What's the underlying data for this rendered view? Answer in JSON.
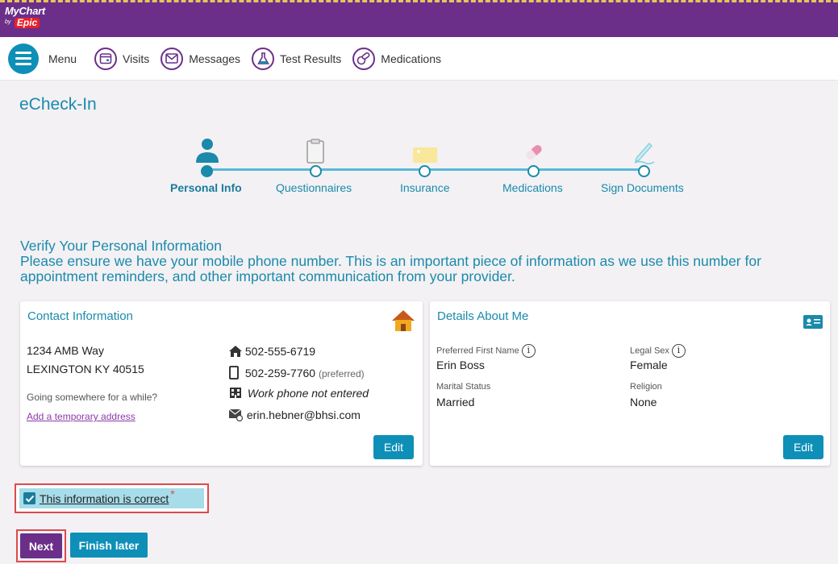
{
  "app": {
    "logo_text": "MyChart",
    "logo_by": "by",
    "logo_brand": "Epic"
  },
  "nav": {
    "menu_label": "Menu",
    "items": [
      {
        "label": "Visits",
        "icon": "calendar-icon"
      },
      {
        "label": "Messages",
        "icon": "envelope-icon"
      },
      {
        "label": "Test Results",
        "icon": "flask-icon"
      },
      {
        "label": "Medications",
        "icon": "pills-icon"
      }
    ]
  },
  "page": {
    "title": "eCheck-In"
  },
  "steps": [
    {
      "label": "Personal Info",
      "icon": "person-icon",
      "active": true
    },
    {
      "label": "Questionnaires",
      "icon": "clipboard-icon",
      "active": false
    },
    {
      "label": "Insurance",
      "icon": "insurance-card-icon",
      "active": false
    },
    {
      "label": "Medications",
      "icon": "pill-icon",
      "active": false
    },
    {
      "label": "Sign Documents",
      "icon": "pen-icon",
      "active": false
    }
  ],
  "verify": {
    "heading": "Verify Your Personal Information",
    "message": "Please ensure we have your mobile phone number. This is an important piece of information as we use this number for appointment reminders, and other important communication from your provider."
  },
  "contact": {
    "title": "Contact Information",
    "address_line1": "1234 AMB Way",
    "address_line2": "LEXINGTON KY 40515",
    "going_somewhere": "Going somewhere for a while?",
    "temp_address_link": "Add a temporary address",
    "home_phone": "502-555-6719",
    "mobile_phone": "502-259-7760",
    "mobile_pref": "(preferred)",
    "work_phone": "Work phone not entered",
    "email": "erin.hebner@bhsi.com",
    "edit_label": "Edit"
  },
  "details": {
    "title": "Details About Me",
    "preferred_name_label": "Preferred First Name",
    "preferred_name_value": "Erin Boss",
    "legal_sex_label": "Legal Sex",
    "legal_sex_value": "Female",
    "marital_label": "Marital Status",
    "marital_value": "Married",
    "religion_label": "Religion",
    "religion_value": "None",
    "edit_label": "Edit"
  },
  "confirm": {
    "label": "This information is correct",
    "checked": true,
    "required_mark": "*"
  },
  "actions": {
    "next_label": "Next",
    "finish_later_label": "Finish later"
  },
  "colors": {
    "brand_purple": "#6b2f8a",
    "accent_teal": "#1a8aab",
    "button_blue": "#0e8fb8",
    "highlight_red": "#e04a4a"
  }
}
